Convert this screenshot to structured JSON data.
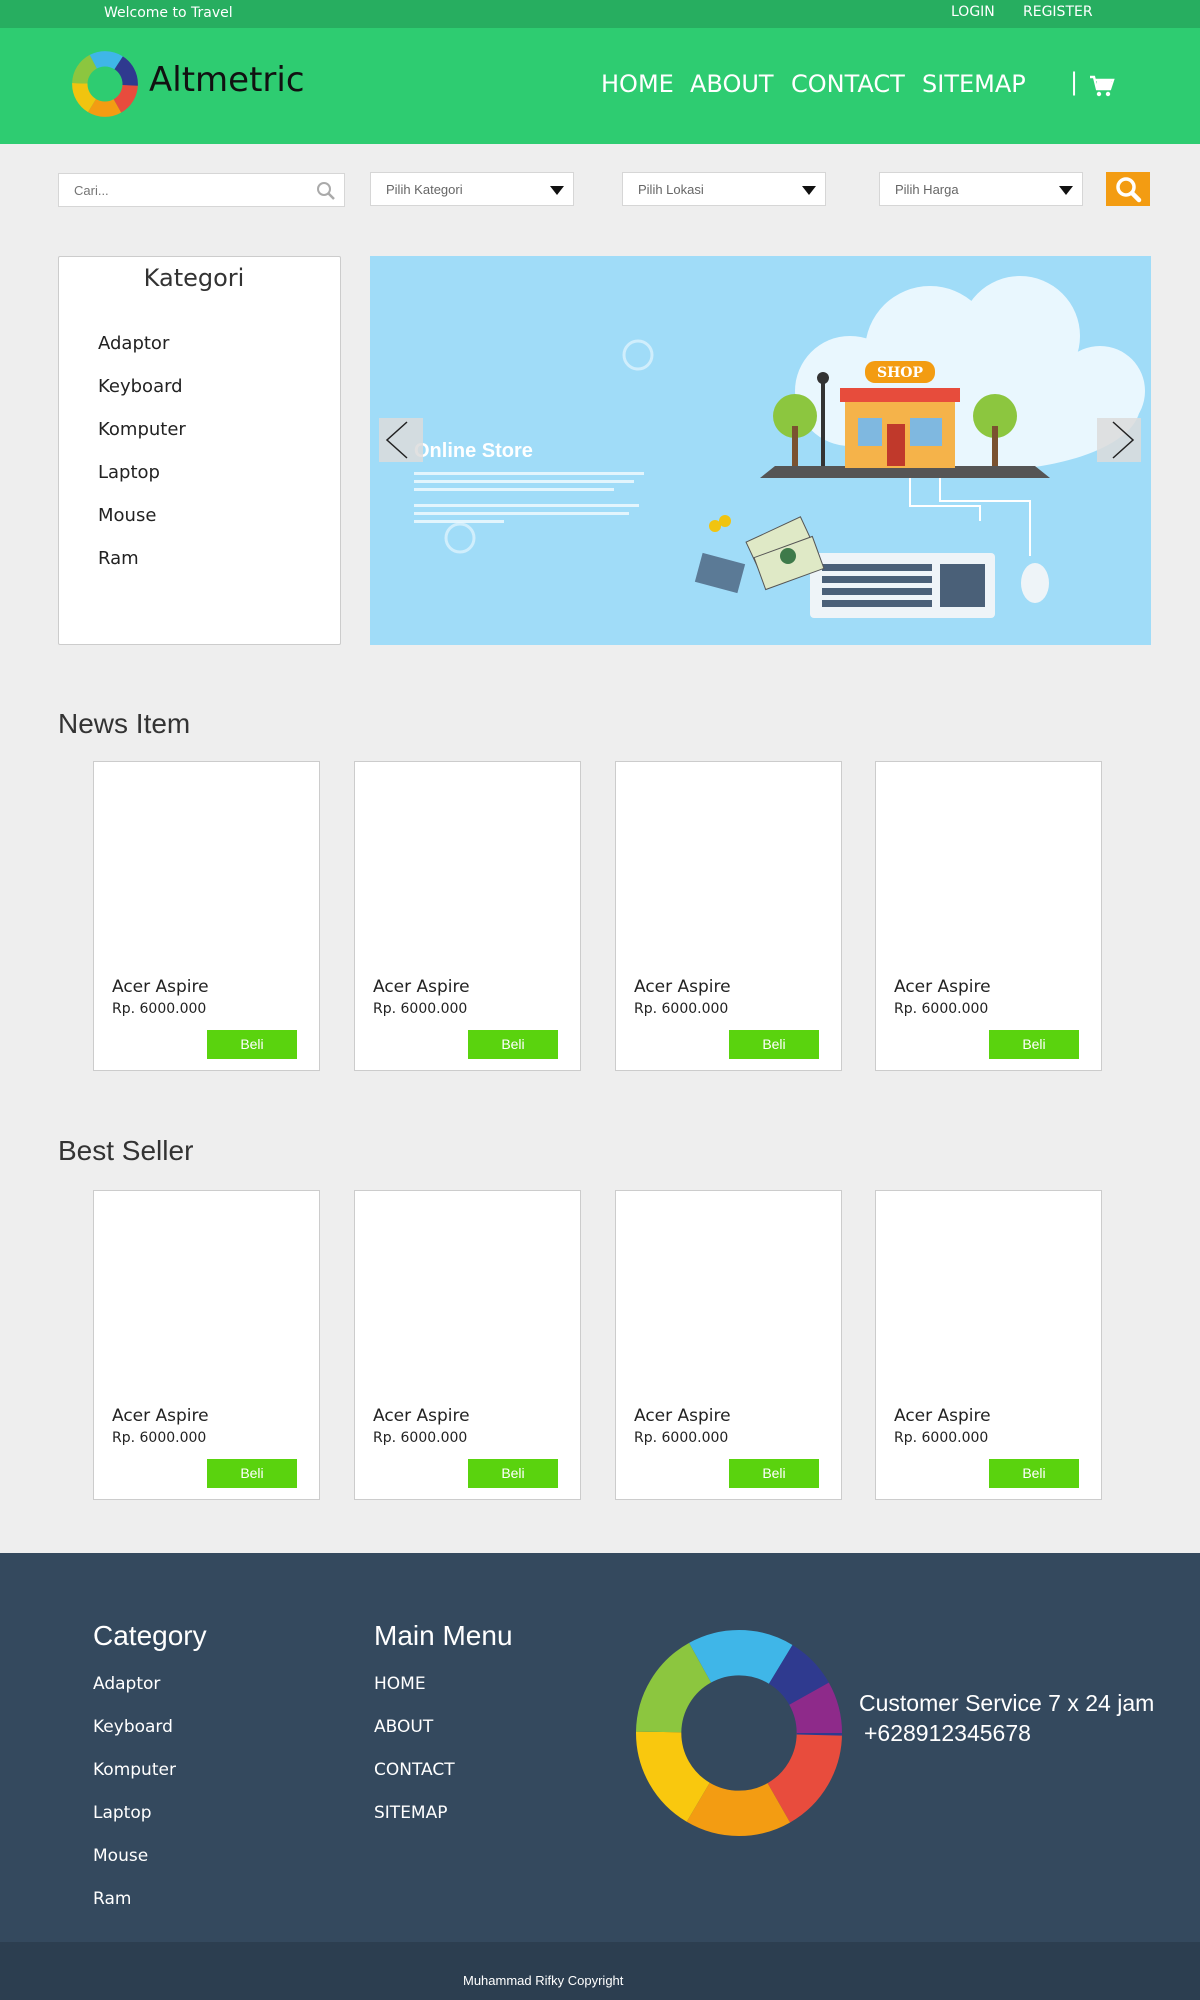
{
  "topbar": {
    "welcome": "Welcome to Travel",
    "login": "LOGIN",
    "register": "REGISTER"
  },
  "header": {
    "brand": "Altmetric",
    "nav": {
      "home": "HOME",
      "about": "ABOUT",
      "contact": "CONTACT",
      "sitemap": "SITEMAP"
    },
    "separator": "|"
  },
  "search": {
    "placeholder": "Cari...",
    "kategori": "Pilih Kategori",
    "lokasi": "Pilih Lokasi",
    "harga": "Pilih Harga"
  },
  "kategori": {
    "title": "Kategori",
    "items": [
      "Adaptor",
      "Keyboard",
      "Komputer",
      "Laptop",
      "Mouse",
      "Ram"
    ]
  },
  "slider": {
    "title": "Online Store",
    "shop_sign": "SHOP"
  },
  "news": {
    "title": "News Item",
    "products": [
      {
        "name": "Acer Aspire",
        "price": "Rp. 6000.000",
        "button": "Beli"
      },
      {
        "name": "Acer Aspire",
        "price": "Rp. 6000.000",
        "button": "Beli"
      },
      {
        "name": "Acer Aspire",
        "price": "Rp. 6000.000",
        "button": "Beli"
      },
      {
        "name": "Acer Aspire",
        "price": "Rp. 6000.000",
        "button": "Beli"
      }
    ]
  },
  "bestseller": {
    "title": "Best Seller",
    "products": [
      {
        "name": "Acer Aspire",
        "price": "Rp. 6000.000",
        "button": "Beli"
      },
      {
        "name": "Acer Aspire",
        "price": "Rp. 6000.000",
        "button": "Beli"
      },
      {
        "name": "Acer Aspire",
        "price": "Rp. 6000.000",
        "button": "Beli"
      },
      {
        "name": "Acer Aspire",
        "price": "Rp. 6000.000",
        "button": "Beli"
      }
    ]
  },
  "footer": {
    "category_title": "Category",
    "categories": [
      "Adaptor",
      "Keyboard",
      "Komputer",
      "Laptop",
      "Mouse",
      "Ram"
    ],
    "menu_title": "Main Menu",
    "menu": [
      "HOME",
      "ABOUT",
      "CONTACT",
      "SITEMAP"
    ],
    "cs_line1": "Customer Service 7 x 24 jam",
    "cs_line2": "+628912345678",
    "copyright": "Muhammad Rifky Copyright"
  },
  "colors": {
    "topbar": "#27ae60",
    "header": "#2ecc71",
    "search_button": "#f39c12",
    "buy_button": "#5ad30e",
    "footer": "#34495e",
    "copyright_bar": "#2c3e50"
  },
  "icons": [
    "search-icon",
    "cart-icon",
    "caret-down-icon",
    "chevron-left-icon",
    "chevron-right-icon"
  ]
}
